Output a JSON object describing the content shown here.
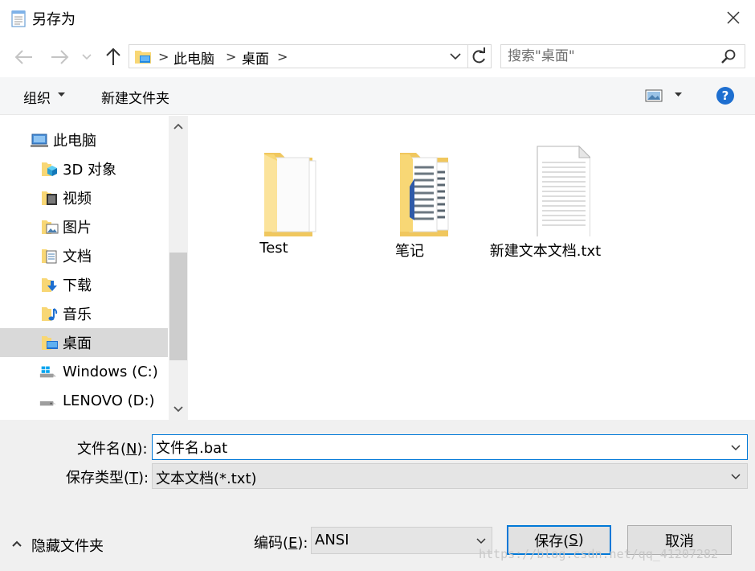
{
  "window": {
    "title": "另存为"
  },
  "address": {
    "crumbs": [
      "此电脑",
      "桌面"
    ],
    "sep": ">"
  },
  "search": {
    "placeholder": "搜索\"桌面\""
  },
  "toolbar": {
    "organize_label": "组织",
    "new_folder_label": "新建文件夹"
  },
  "nav": {
    "items": [
      {
        "label": "此电脑",
        "icon": "computer-icon",
        "indent": 0
      },
      {
        "label": "3D 对象",
        "icon": "3d-objects-icon",
        "indent": 1
      },
      {
        "label": "视频",
        "icon": "videos-icon",
        "indent": 1
      },
      {
        "label": "图片",
        "icon": "pictures-icon",
        "indent": 1
      },
      {
        "label": "文档",
        "icon": "documents-icon",
        "indent": 1
      },
      {
        "label": "下载",
        "icon": "downloads-icon",
        "indent": 1
      },
      {
        "label": "音乐",
        "icon": "music-icon",
        "indent": 1
      },
      {
        "label": "桌面",
        "icon": "desktop-icon",
        "indent": 1,
        "selected": true
      },
      {
        "label": "Windows (C:)",
        "icon": "drive-c-icon",
        "indent": 1
      },
      {
        "label": "LENOVO (D:)",
        "icon": "drive-d-icon",
        "indent": 1
      }
    ]
  },
  "files": [
    {
      "name": "Test",
      "type": "folder"
    },
    {
      "name": "笔记",
      "type": "folder-docs"
    },
    {
      "name": "新建文本文档.txt",
      "type": "text-file"
    }
  ],
  "form": {
    "filename_label_pre": "文件名(",
    "filename_label_key": "N",
    "filename_label_post": "):",
    "filename_value": "文件名.bat",
    "filetype_label_pre": "保存类型(",
    "filetype_label_key": "T",
    "filetype_label_post": "):",
    "filetype_value": "文本文档(*.txt)",
    "encoding_label_pre": "编码(",
    "encoding_label_key": "E",
    "encoding_label_post": "):",
    "encoding_value": "ANSI",
    "hide_folders_label": "隐藏文件夹",
    "save_label_pre": "保存(",
    "save_label_key": "S",
    "save_label_post": ")",
    "cancel_label": "取消"
  },
  "watermark": "https://blog.csdn.net/qq_41207282",
  "colors": {
    "accent": "#0078d7",
    "selected": "#d9d9d9",
    "panel": "#f0f0f0",
    "folder": "#f8d775"
  }
}
